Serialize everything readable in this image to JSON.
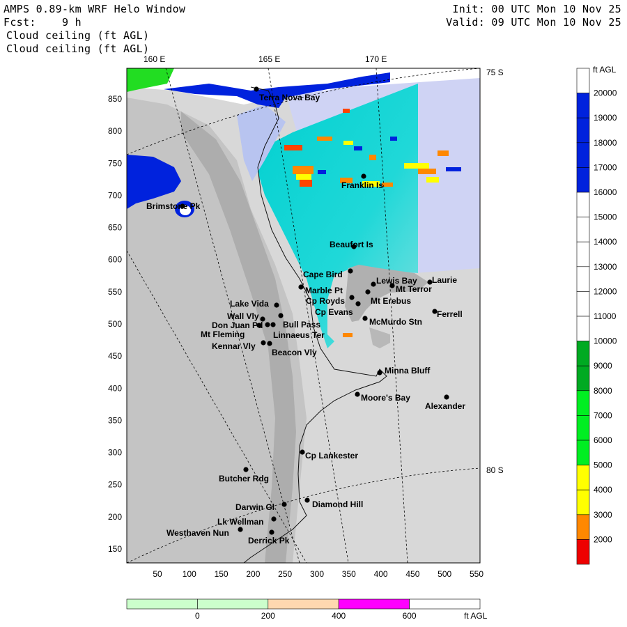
{
  "header": {
    "model": "AMPS 0.89-km WRF Helo Window",
    "fcst_label": "Fcst:",
    "fcst_value": "9 h",
    "field_1": "Cloud ceiling (ft AGL)",
    "field_2": "Cloud ceiling (ft AGL)",
    "init": "Init: 00 UTC Mon 10 Nov 25",
    "valid": "Valid: 09 UTC Mon 10 Nov 25"
  },
  "map": {
    "lon_labels": [
      "160 E",
      "165 E",
      "170 E"
    ],
    "lat_labels": [
      "75 S",
      "80 S"
    ],
    "x_ticks": [
      "50",
      "100",
      "150",
      "200",
      "250",
      "300",
      "350",
      "400",
      "450",
      "500",
      "550"
    ],
    "y_ticks": [
      "850",
      "800",
      "750",
      "700",
      "650",
      "600",
      "550",
      "500",
      "450",
      "400",
      "350",
      "300",
      "250",
      "200",
      "150"
    ],
    "places": [
      {
        "name": "Terra Nova Bay"
      },
      {
        "name": "Franklin Is"
      },
      {
        "name": "Brimstone Pk"
      },
      {
        "name": "Beaufort Is"
      },
      {
        "name": "Cape Bird"
      },
      {
        "name": "Lewis Bay"
      },
      {
        "name": "Laurie"
      },
      {
        "name": "Mt Terror"
      },
      {
        "name": "Marble Pt"
      },
      {
        "name": "Cp Royds"
      },
      {
        "name": "Mt Erebus"
      },
      {
        "name": "Lake Vida"
      },
      {
        "name": "Cp Evans"
      },
      {
        "name": "Ferrell"
      },
      {
        "name": "Wall Vly"
      },
      {
        "name": "Bull Pass"
      },
      {
        "name": "McMurdo Stn"
      },
      {
        "name": "Don Juan Pd"
      },
      {
        "name": "Mt Fleming"
      },
      {
        "name": "Linnaeus Ter"
      },
      {
        "name": "Kennar Vly"
      },
      {
        "name": "Beacon Vly"
      },
      {
        "name": "Minna Bluff"
      },
      {
        "name": "Moore's Bay"
      },
      {
        "name": "Alexander"
      },
      {
        "name": "Cp Lankester"
      },
      {
        "name": "Butcher Rdg"
      },
      {
        "name": "Darwin Gl"
      },
      {
        "name": "Diamond Hill"
      },
      {
        "name": "Lk Wellman"
      },
      {
        "name": "Westhaven Nun"
      },
      {
        "name": "Derrick Pk"
      }
    ]
  },
  "colorbar": {
    "unit": "ft AGL",
    "levels": [
      "20000",
      "19000",
      "18000",
      "17000",
      "16000",
      "15000",
      "14000",
      "13000",
      "12000",
      "11000",
      "10000",
      "9000",
      "8000",
      "7000",
      "6000",
      "5000",
      "4000",
      "3000",
      "2000"
    ],
    "colors": [
      "#ffffff",
      "#0022dd",
      "#0022dd",
      "#0022dd",
      "#0022dd",
      "#ffffff",
      "#ffffff",
      "#ffffff",
      "#ffffff",
      "#ffffff",
      "#ffffff",
      "#00aa22",
      "#00aa22",
      "#00ee22",
      "#00ee22",
      "#00ee22",
      "#ffff00",
      "#ffff00",
      "#ff8800",
      "#ee0000"
    ]
  },
  "terrain_bar": {
    "unit": "ft AGL",
    "labels": [
      "0",
      "200",
      "400",
      "600"
    ],
    "colors": [
      "#ccffcc",
      "#ccffcc",
      "#ffd8b0",
      "#ff00ff",
      "#ffffff"
    ]
  }
}
